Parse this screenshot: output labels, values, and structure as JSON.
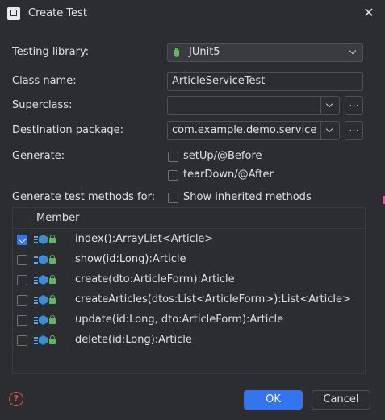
{
  "window": {
    "title": "Create Test"
  },
  "form": {
    "testing_library_label": "Testing library:",
    "testing_library_value": "JUnit5",
    "class_name_label": "Class name:",
    "class_name_value": "ArticleServiceTest",
    "superclass_label": "Superclass:",
    "superclass_value": "",
    "destination_label": "Destination package:",
    "destination_value": "com.example.demo.service",
    "browse_label": "...",
    "generate_label": "Generate:",
    "setup_label": "setUp/@Before",
    "teardown_label": "tearDown/@After",
    "methods_label": "Generate test methods for:",
    "inherited_label": "Show inherited methods"
  },
  "table": {
    "header": "Member",
    "rows": [
      {
        "checked": true,
        "text": "index():ArrayList<Article>"
      },
      {
        "checked": false,
        "text": "show(id:Long):Article"
      },
      {
        "checked": false,
        "text": "create(dto:ArticleForm):Article"
      },
      {
        "checked": false,
        "text": "createArticles(dtos:List<ArticleForm>):List<Article>"
      },
      {
        "checked": false,
        "text": "update(id:Long, dto:ArticleForm):Article"
      },
      {
        "checked": false,
        "text": "delete(id:Long):Article"
      }
    ]
  },
  "footer": {
    "ok_label": "OK",
    "cancel_label": "Cancel",
    "help_glyph": "?"
  },
  "colors": {
    "background": "#2b2d30",
    "accent": "#3574f0",
    "help": "#d9534f"
  },
  "icons": [
    "junit-icon",
    "close-icon",
    "chevron-down-icon",
    "method-icon",
    "public-lock-icon",
    "help-icon"
  ]
}
